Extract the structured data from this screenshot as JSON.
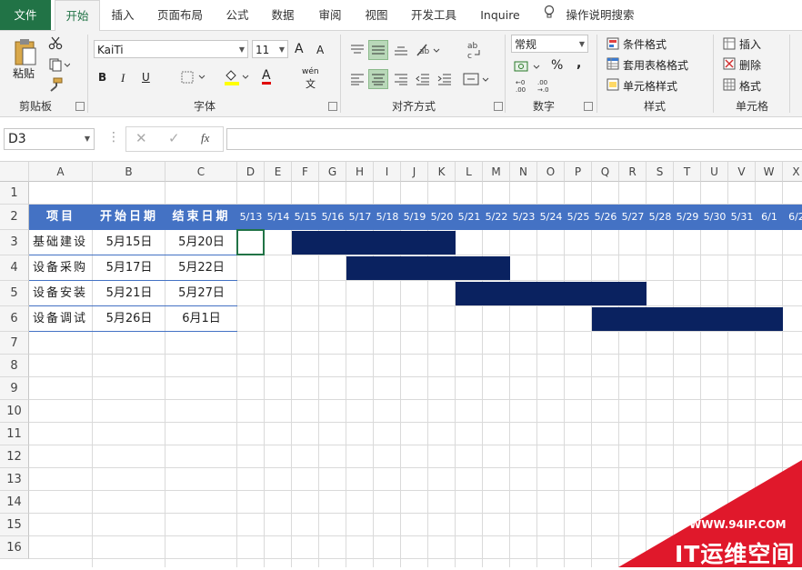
{
  "tabs": [
    "文件",
    "开始",
    "插入",
    "页面布局",
    "公式",
    "数据",
    "审阅",
    "视图",
    "开发工具",
    "Inquire",
    "操作说明搜索"
  ],
  "ribbon": {
    "clipboard": {
      "paste": "粘贴",
      "label": "剪贴板"
    },
    "font": {
      "name": "KaiTi",
      "size": "11",
      "bold": "B",
      "italic": "I",
      "underline": "U",
      "label": "字体",
      "grow": "A",
      "shrink": "A",
      "wen": "wén",
      "wen2": "文",
      "fontA": "A"
    },
    "align": {
      "label": "对齐方式"
    },
    "number": {
      "format": "常规",
      "percent": "%",
      "comma": ",",
      "label": "数字"
    },
    "styles": {
      "conditional": "条件格式",
      "table": "套用表格格式",
      "cell": "单元格样式",
      "label": "样式"
    },
    "cells": {
      "insert": "插入",
      "delete": "删除",
      "format": "格式",
      "label": "单元格"
    }
  },
  "formula_bar": {
    "name_box": "D3",
    "fx": "fx",
    "value": ""
  },
  "columns": [
    "A",
    "B",
    "C",
    "D",
    "E",
    "F",
    "G",
    "H",
    "I",
    "J",
    "K",
    "L",
    "M",
    "N",
    "O",
    "P",
    "Q",
    "R",
    "S",
    "T",
    "U",
    "V",
    "W",
    "X"
  ],
  "rows": [
    "1",
    "2",
    "3",
    "4",
    "5",
    "6",
    "7",
    "8",
    "9",
    "10",
    "11",
    "12",
    "13",
    "14",
    "15",
    "16"
  ],
  "table": {
    "headers": [
      "项目",
      "开始日期",
      "结束日期"
    ],
    "dates": [
      "5/13",
      "5/14",
      "5/15",
      "5/16",
      "5/17",
      "5/18",
      "5/19",
      "5/20",
      "5/21",
      "5/22",
      "5/23",
      "5/24",
      "5/25",
      "5/26",
      "5/27",
      "5/28",
      "5/29",
      "5/30",
      "5/31",
      "6/1",
      "6/2"
    ],
    "rows": [
      {
        "task": "基础建设",
        "start": "5月15日",
        "end": "5月20日",
        "start_idx": 2,
        "end_idx": 7
      },
      {
        "task": "设备采购",
        "start": "5月17日",
        "end": "5月22日",
        "start_idx": 4,
        "end_idx": 9
      },
      {
        "task": "设备安装",
        "start": "5月21日",
        "end": "5月27日",
        "start_idx": 8,
        "end_idx": 14
      },
      {
        "task": "设备调试",
        "start": "5月26日",
        "end": "6月1日",
        "start_idx": 13,
        "end_idx": 19
      }
    ]
  },
  "watermark": {
    "url": "WWW.94IP.COM",
    "brand": "IT运维空间"
  },
  "colors": {
    "excel_green": "#217346",
    "header_blue": "#4472c4",
    "bar_navy": "#0a2260",
    "watermark_red": "#e0182b"
  }
}
